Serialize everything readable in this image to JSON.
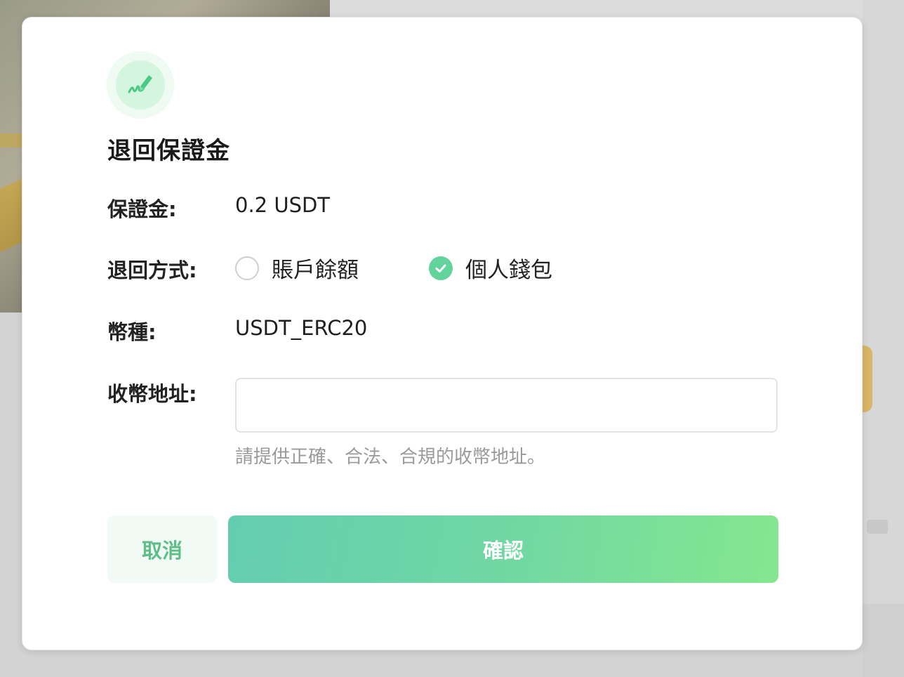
{
  "dialog": {
    "icon": "signature-pen-icon",
    "title": "退回保證金",
    "deposit": {
      "label": "保證金:",
      "value": "0.2 USDT"
    },
    "refund_method": {
      "label": "退回方式:",
      "options": [
        {
          "label": "賬戶餘額",
          "checked": false
        },
        {
          "label": "個人錢包",
          "checked": true
        }
      ]
    },
    "currency": {
      "label": "幣種:",
      "value": "USDT_ERC20"
    },
    "address": {
      "label": "收幣地址:",
      "value": "",
      "placeholder": "",
      "hint": "請提供正確、合法、合規的收幣地址。"
    },
    "buttons": {
      "cancel": "取消",
      "confirm": "確認"
    }
  },
  "colors": {
    "accent": "#62d49b",
    "cancel_text": "#5fbe88",
    "cancel_bg": "#f1faf4",
    "confirm_gradient_start": "#64cdb0",
    "confirm_gradient_end": "#84e78f"
  }
}
